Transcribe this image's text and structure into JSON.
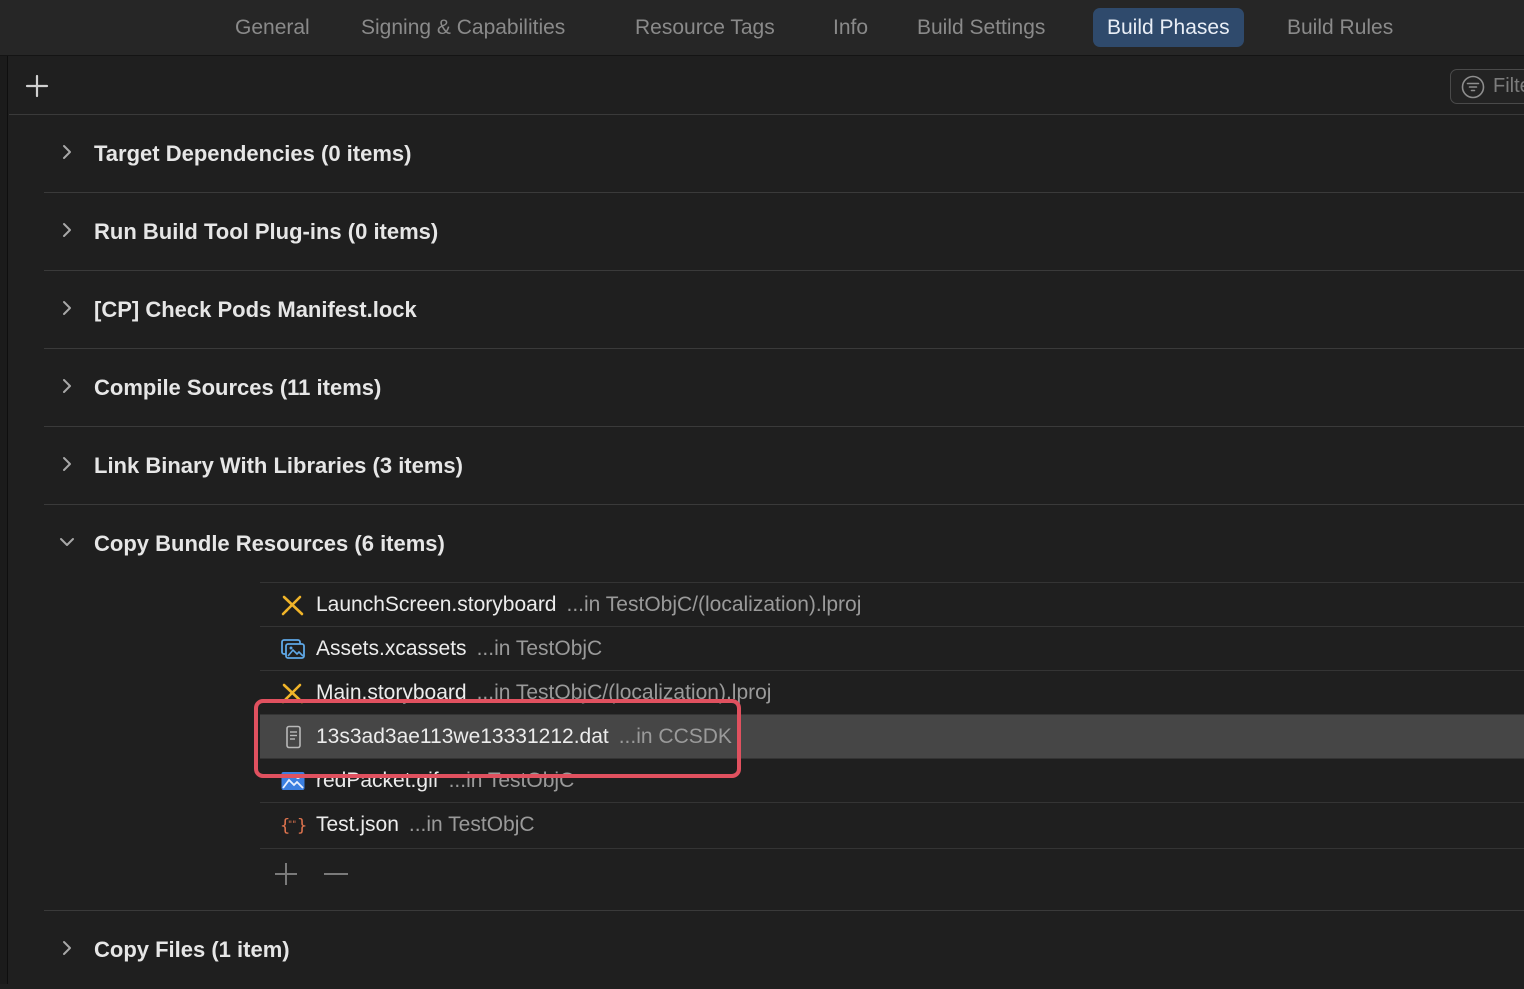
{
  "tabs": [
    {
      "label": "General"
    },
    {
      "label": "Signing & Capabilities"
    },
    {
      "label": "Resource Tags"
    },
    {
      "label": "Info"
    },
    {
      "label": "Build Settings"
    },
    {
      "label": "Build Phases",
      "active": true
    },
    {
      "label": "Build Rules"
    }
  ],
  "toolbar": {
    "add_icon": "plus-icon",
    "filter_placeholder": "Filter"
  },
  "phases": [
    {
      "title": "Target Dependencies (0 items)",
      "expanded": false
    },
    {
      "title": "Run Build Tool Plug-ins (0 items)",
      "expanded": false
    },
    {
      "title": "[CP] Check Pods Manifest.lock",
      "expanded": false
    },
    {
      "title": "Compile Sources (11 items)",
      "expanded": false
    },
    {
      "title": "Link Binary With Libraries (3 items)",
      "expanded": false
    },
    {
      "title": "Copy Bundle Resources (6 items)",
      "expanded": true
    },
    {
      "title": "Copy Files (1 item)",
      "expanded": false
    }
  ],
  "resources": [
    {
      "name": "LaunchScreen.storyboard",
      "location": "...in TestObjC/(localization).lproj",
      "icon": "storyboard-icon"
    },
    {
      "name": "Assets.xcassets",
      "location": "...in TestObjC",
      "icon": "asset-catalog-icon"
    },
    {
      "name": "Main.storyboard",
      "location": "...in TestObjC/(localization).lproj",
      "icon": "storyboard-icon"
    },
    {
      "name": "13s3ad3ae113we13331212.dat",
      "location": "...in CCSDK",
      "icon": "document-icon",
      "selected": true
    },
    {
      "name": "redPacket.gif",
      "location": "...in TestObjC",
      "icon": "image-icon"
    },
    {
      "name": "Test.json",
      "location": "...in TestObjC",
      "icon": "json-icon"
    }
  ],
  "colors": {
    "accent_tab": "#2f4a6c",
    "highlight": "#e0515f",
    "selected_row": "#464646"
  }
}
